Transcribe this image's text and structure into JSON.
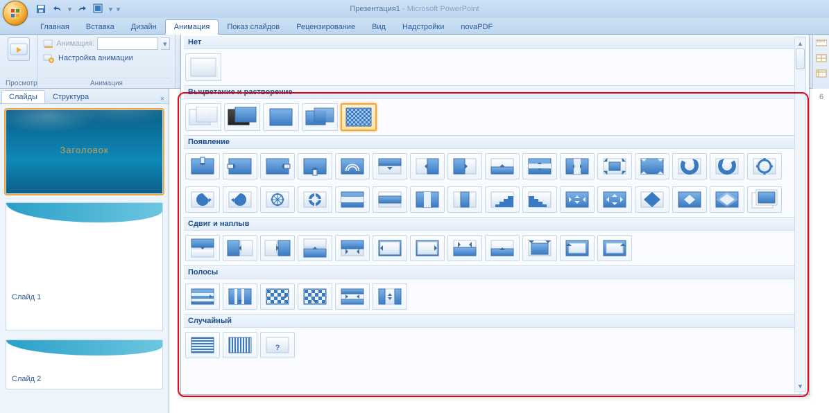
{
  "app": {
    "doc": "Презентация1",
    "sep": " - ",
    "name": "Microsoft PowerPoint"
  },
  "qat": {
    "save": "save-icon",
    "undo": "undo-icon",
    "redo": "redo-icon",
    "style": "style-icon"
  },
  "tabs": [
    "Главная",
    "Вставка",
    "Дизайн",
    "Анимация",
    "Показ слайдов",
    "Рецензирование",
    "Вид",
    "Надстройки",
    "novaPDF"
  ],
  "activeTab": 3,
  "ribbon": {
    "previewGroup": "Просмотр",
    "previewBtn": "Просмотр",
    "animGroup": "Анимация",
    "animLabel": "Анимация:",
    "customAnim": "Настройка анимации"
  },
  "gallery": {
    "sections": {
      "none": "Нет",
      "fade": "Выцветание и растворение",
      "appear": "Появление",
      "shift": "Сдвиг и наплыв",
      "stripes": "Полосы",
      "random": "Случайный"
    }
  },
  "leftPane": {
    "tabs": {
      "slides": "Слайды",
      "outline": "Структура"
    },
    "slide1": {
      "title": "Заголовок",
      "label": "Слайд 1"
    },
    "slide2": {
      "label": "Слайд 2"
    }
  },
  "ruler": {
    "mark": "6"
  }
}
